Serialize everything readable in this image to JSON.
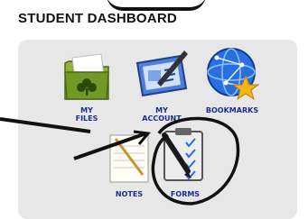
{
  "header": {
    "title": "STUDENT DASHBOARD"
  },
  "tiles": [
    {
      "label_line1": "MY",
      "label_line2": "FILES",
      "icon": "folder-icon"
    },
    {
      "label_line1": "MY",
      "label_line2": "ACCOUNT",
      "icon": "account-card-icon"
    },
    {
      "label": "BOOKMARKS",
      "icon": "globe-star-icon"
    },
    {
      "label": "NOTES",
      "icon": "notepad-icon"
    },
    {
      "label": "FORMS",
      "icon": "clipboard-checklist-icon"
    }
  ],
  "colors": {
    "label": "#1a2f8c",
    "panel": "#e7e7e7",
    "annotation": "#111111"
  }
}
